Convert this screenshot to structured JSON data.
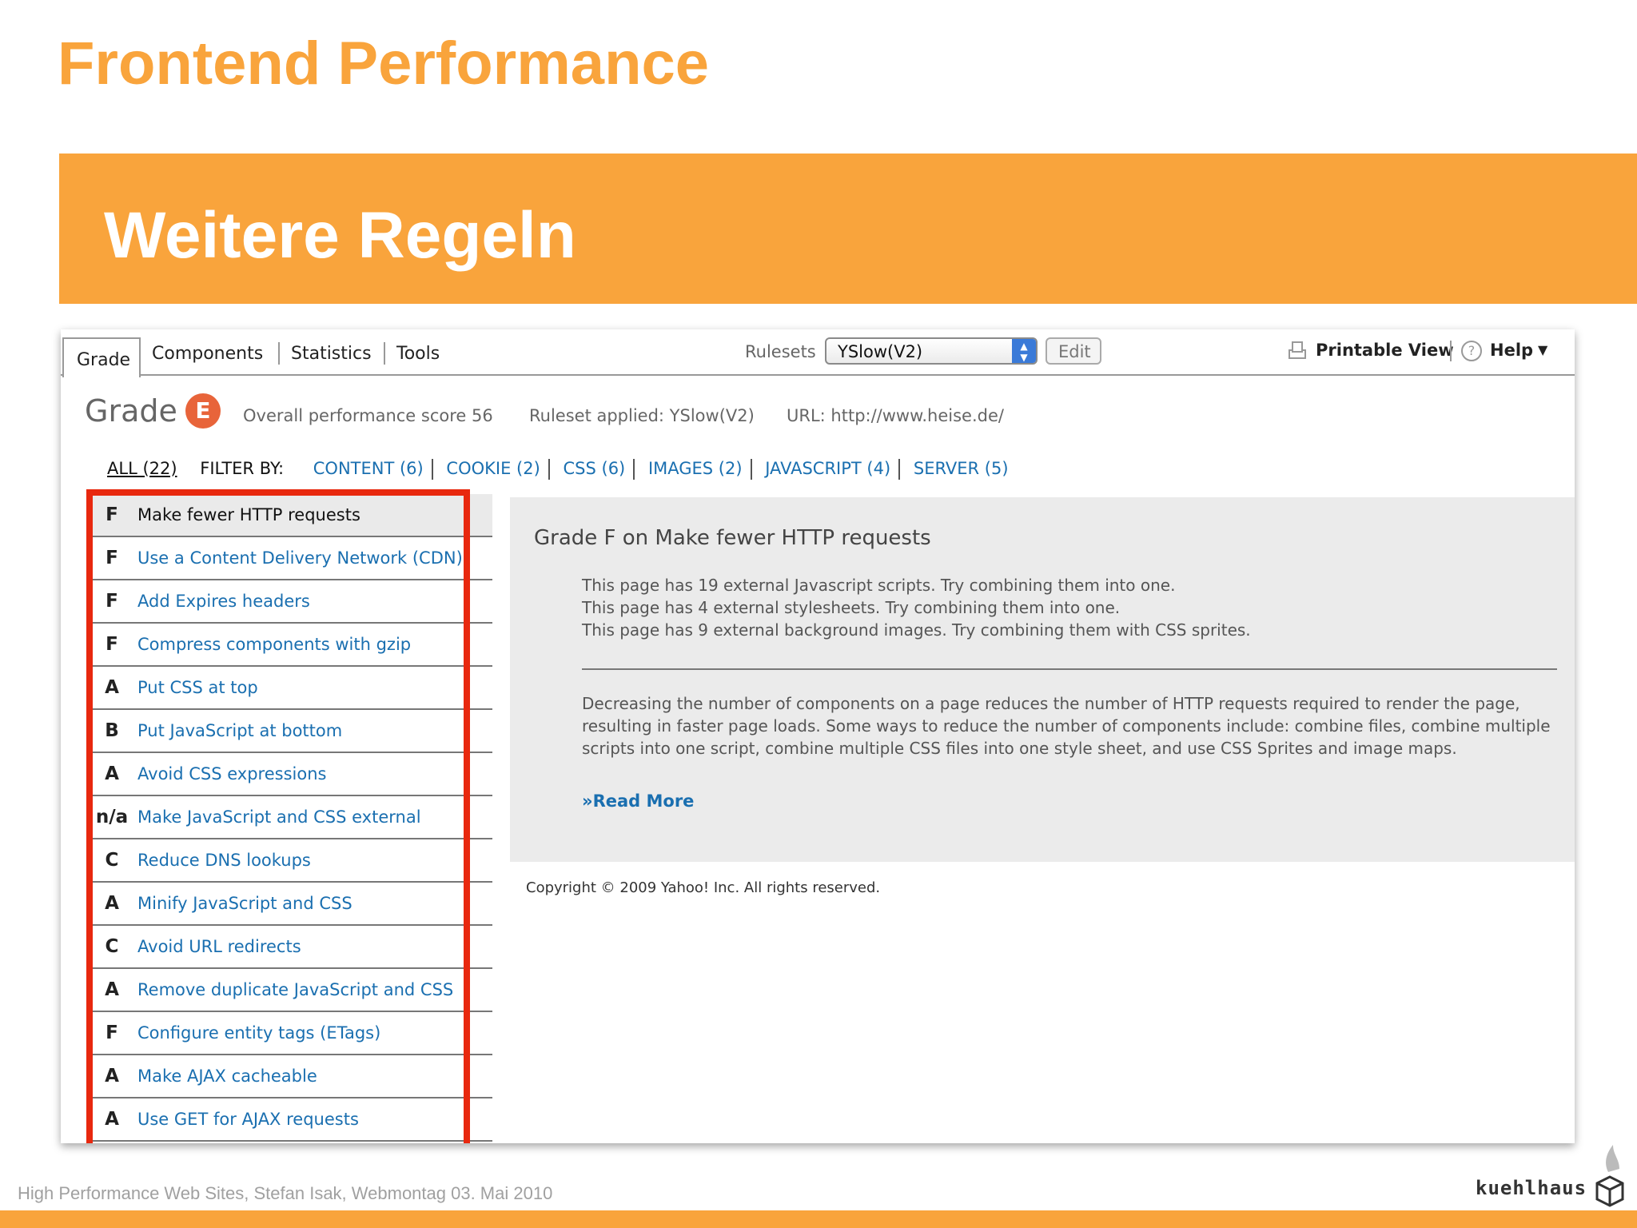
{
  "slide": {
    "title": "Frontend Performance",
    "banner_title": "Weitere Regeln",
    "footer": "High Performance Web Sites, Stefan Isak, Webmontag 03. Mai 2010",
    "logo_text": "kuehlhaus",
    "accent_color": "#f9a43c"
  },
  "yslow": {
    "tabs": [
      "Grade",
      "Components",
      "Statistics",
      "Tools"
    ],
    "rulesets_label": "Rulesets",
    "ruleset_selected": "YSlow(V2)",
    "edit_label": "Edit",
    "printable_label": "Printable View",
    "help_label": "Help",
    "grade_word": "Grade",
    "grade_letter": "E",
    "score_text": "Overall performance score 56",
    "ruleset_applied": "Ruleset applied: YSlow(V2)",
    "url_text": "URL: http://www.heise.de/",
    "filter_all": "ALL (22)",
    "filter_by": "FILTER BY:",
    "filters": [
      "CONTENT (6)",
      "COOKIE (2)",
      "CSS (6)",
      "IMAGES (2)",
      "JAVASCRIPT (4)",
      "SERVER (5)"
    ],
    "rules": [
      {
        "grade": "F",
        "label": "Make fewer HTTP requests"
      },
      {
        "grade": "F",
        "label": "Use a Content Delivery Network (CDN)"
      },
      {
        "grade": "F",
        "label": "Add Expires headers"
      },
      {
        "grade": "F",
        "label": "Compress components with gzip"
      },
      {
        "grade": "A",
        "label": "Put CSS at top"
      },
      {
        "grade": "B",
        "label": "Put JavaScript at bottom"
      },
      {
        "grade": "A",
        "label": "Avoid CSS expressions"
      },
      {
        "grade": "n/a",
        "label": "Make JavaScript and CSS external"
      },
      {
        "grade": "C",
        "label": "Reduce DNS lookups"
      },
      {
        "grade": "A",
        "label": "Minify JavaScript and CSS"
      },
      {
        "grade": "C",
        "label": "Avoid URL redirects"
      },
      {
        "grade": "A",
        "label": "Remove duplicate JavaScript and CSS"
      },
      {
        "grade": "F",
        "label": "Configure entity tags (ETags)"
      },
      {
        "grade": "A",
        "label": "Make AJAX cacheable"
      },
      {
        "grade": "A",
        "label": "Use GET for AJAX requests"
      }
    ],
    "detail": {
      "title": "Grade F on Make fewer HTTP requests",
      "line1": "This page has 19 external Javascript scripts. Try combining them into one.",
      "line2": "This page has 4 external stylesheets. Try combining them into one.",
      "line3": "This page has 9 external background images. Try combining them with CSS sprites.",
      "description": "Decreasing the number of components on a page reduces the number of HTTP requests required to render the page, resulting in faster page loads. Some ways to reduce the number of components include: combine files, combine multiple scripts into one script, combine multiple CSS files into one style sheet, and use CSS Sprites and image maps.",
      "read_more": "»Read More"
    },
    "copyright": "Copyright © 2009 Yahoo! Inc. All rights reserved."
  }
}
